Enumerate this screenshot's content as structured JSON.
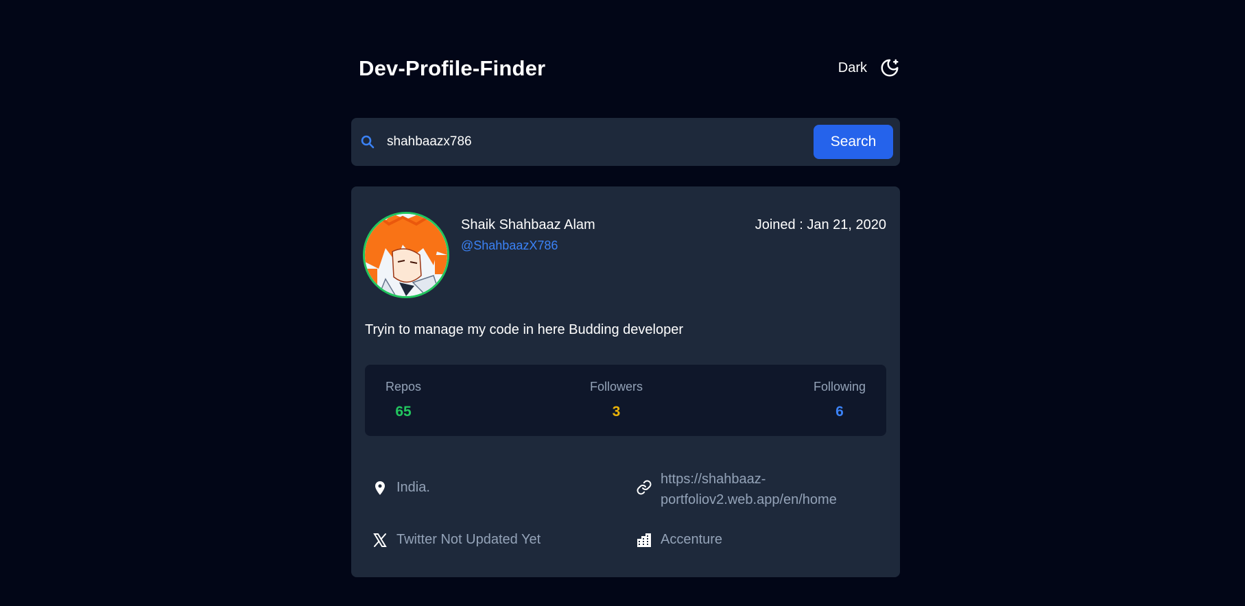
{
  "header": {
    "title": "Dev-Profile-Finder",
    "theme_label": "Dark",
    "theme_icon": "moon-icon"
  },
  "search": {
    "value": "shahbaazx786",
    "button_label": "Search",
    "icon": "search-icon"
  },
  "profile": {
    "name": "Shaik Shahbaaz Alam",
    "username": "@ShahbaazX786",
    "joined": "Joined : Jan 21, 2020",
    "bio": "Tryin to manage my code in here Budding developer",
    "avatar_icon": "avatar-image"
  },
  "stats": [
    {
      "label": "Repos",
      "value": "65",
      "color": "#22c55e"
    },
    {
      "label": "Followers",
      "value": "3",
      "color": "#eab308"
    },
    {
      "label": "Following",
      "value": "6",
      "color": "#3b82f6"
    }
  ],
  "info": {
    "location": "India.",
    "website": "https://shahbaaz-portfoliov2.web.app/en/home",
    "twitter": "Twitter Not Updated Yet",
    "company": "Accenture"
  },
  "colors": {
    "background": "#020617",
    "card": "#1e293b",
    "stats_panel": "#0f172a",
    "accent": "#2563eb",
    "avatar_ring": "#22c55e"
  }
}
